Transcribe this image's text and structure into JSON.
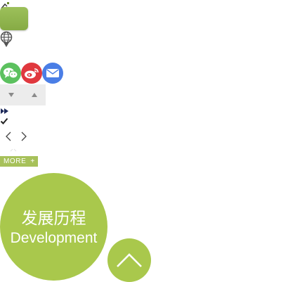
{
  "icons": {
    "corner": "corner-glyph-icon",
    "globe": "globe-pin-icon",
    "wechat": "wechat-icon",
    "weibo": "weibo-icon",
    "mail": "mail-icon",
    "arrow_down": "arrow-down-icon",
    "arrow_up": "arrow-up-icon",
    "play": "play-icon",
    "check": "check-icon",
    "prev": "chevron-left-icon",
    "next": "chevron-right-icon",
    "back_to_top": "chevron-up-icon"
  },
  "colors": {
    "accent_green": "#a9c84c",
    "tag_green": "#a7c15a",
    "wechat": "#5cc15f",
    "weibo": "#e0383e",
    "mail": "#4a7ee6",
    "button_gray": "#ececec"
  },
  "more_tag": {
    "label": "MORE",
    "plus": "+"
  },
  "development": {
    "title_zh": "发展历程",
    "title_en": "Development"
  }
}
